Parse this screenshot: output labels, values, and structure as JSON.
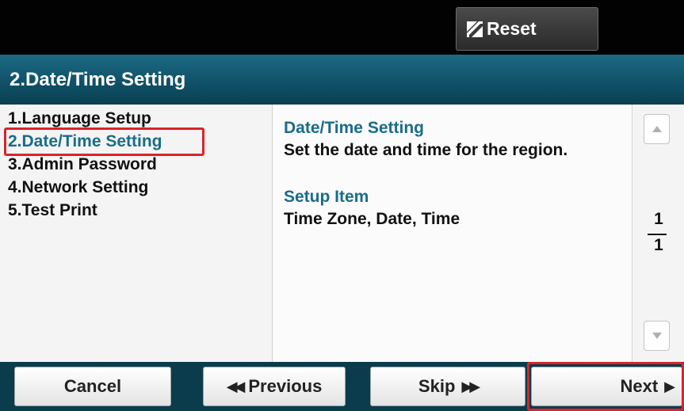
{
  "topbar": {
    "reset_label": "Reset"
  },
  "titlebar": {
    "title": "2.Date/Time Setting"
  },
  "menu": {
    "items": [
      {
        "label": "1.Language Setup"
      },
      {
        "label": "2.Date/Time Setting",
        "selected": true
      },
      {
        "label": "3.Admin Password"
      },
      {
        "label": "4.Network Setting"
      },
      {
        "label": "5.Test Print"
      }
    ]
  },
  "detail": {
    "heading": "Date/Time Setting",
    "description": "Set the date and time for the region.",
    "setup_heading": "Setup Item",
    "setup_items": "Time Zone, Date, Time"
  },
  "pager": {
    "current": "1",
    "total": "1"
  },
  "bottom": {
    "cancel_label": "Cancel",
    "previous_label": "Previous",
    "skip_label": "Skip",
    "next_label": "Next"
  },
  "colors": {
    "accent": "#1a6c8a",
    "highlight": "#d9242a",
    "title_bar": "#0f4f66"
  }
}
